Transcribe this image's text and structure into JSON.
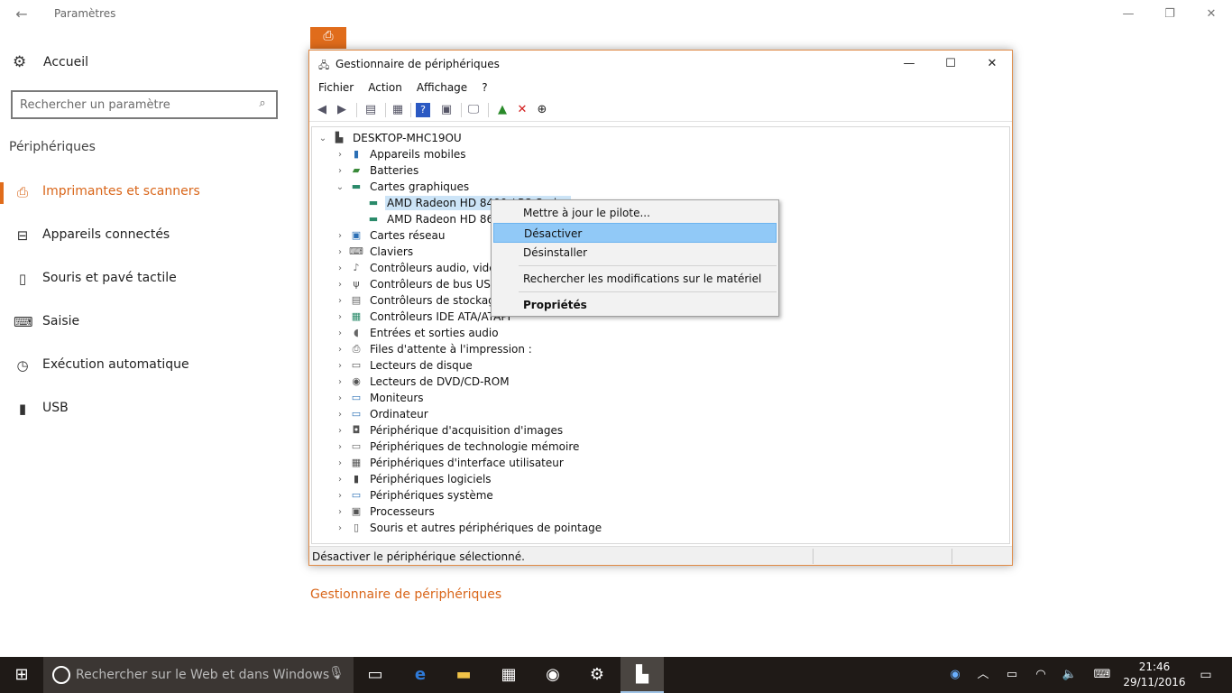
{
  "settings": {
    "title": "Paramètres",
    "home_label": "Accueil",
    "search_placeholder": "Rechercher un paramètre",
    "section_heading": "Périphériques",
    "nav": [
      {
        "label": "Imprimantes et scanners",
        "icon": "printer-icon",
        "active": true
      },
      {
        "label": "Appareils connectés",
        "icon": "devices-icon",
        "active": false
      },
      {
        "label": "Souris et pavé tactile",
        "icon": "mouse-icon",
        "active": false
      },
      {
        "label": "Saisie",
        "icon": "keyboard-icon",
        "active": false
      },
      {
        "label": "Exécution automatique",
        "icon": "autoplay-icon",
        "active": false
      },
      {
        "label": "USB",
        "icon": "usb-icon",
        "active": false
      }
    ],
    "related_link": "Gestionnaire de périphériques"
  },
  "device_manager": {
    "title": "Gestionnaire de périphériques",
    "menu": [
      "Fichier",
      "Action",
      "Affichage",
      "?"
    ],
    "root": "DESKTOP-MHC19OU",
    "tree": [
      {
        "label": "Appareils mobiles",
        "icon": "phone-icon",
        "expanded": false,
        "level": 1
      },
      {
        "label": "Batteries",
        "icon": "battery-icon",
        "expanded": false,
        "level": 1
      },
      {
        "label": "Cartes graphiques",
        "icon": "display-adapter-icon",
        "expanded": true,
        "level": 1
      },
      {
        "label": "AMD Radeon HD 8400 / R3 Series",
        "icon": "display-adapter-icon",
        "level": 2,
        "selected": true
      },
      {
        "label": "AMD Radeon HD 8600",
        "icon": "display-adapter-icon",
        "level": 2
      },
      {
        "label": "Cartes réseau",
        "icon": "network-icon",
        "expanded": false,
        "level": 1
      },
      {
        "label": "Claviers",
        "icon": "keyboard-icon",
        "expanded": false,
        "level": 1
      },
      {
        "label": "Contrôleurs audio, vidéo et jeu",
        "icon": "speaker-icon",
        "expanded": false,
        "level": 1
      },
      {
        "label": "Contrôleurs de bus USB",
        "icon": "usb-icon",
        "expanded": false,
        "level": 1
      },
      {
        "label": "Contrôleurs de stockage",
        "icon": "storage-icon",
        "expanded": false,
        "level": 1
      },
      {
        "label": "Contrôleurs IDE ATA/ATAPI",
        "icon": "ide-icon",
        "expanded": false,
        "level": 1
      },
      {
        "label": "Entrées et sorties audio",
        "icon": "audio-io-icon",
        "expanded": false,
        "level": 1
      },
      {
        "label": "Files d'attente à l'impression :",
        "icon": "print-queue-icon",
        "expanded": false,
        "level": 1
      },
      {
        "label": "Lecteurs de disque",
        "icon": "disk-icon",
        "expanded": false,
        "level": 1
      },
      {
        "label": "Lecteurs de DVD/CD-ROM",
        "icon": "dvd-icon",
        "expanded": false,
        "level": 1
      },
      {
        "label": "Moniteurs",
        "icon": "monitor-icon",
        "expanded": false,
        "level": 1
      },
      {
        "label": "Ordinateur",
        "icon": "computer-icon",
        "expanded": false,
        "level": 1
      },
      {
        "label": "Périphérique d'acquisition d'images",
        "icon": "camera-icon",
        "expanded": false,
        "level": 1
      },
      {
        "label": "Périphériques de technologie mémoire",
        "icon": "memory-icon",
        "expanded": false,
        "level": 1
      },
      {
        "label": "Périphériques d'interface utilisateur",
        "icon": "hid-icon",
        "expanded": false,
        "level": 1
      },
      {
        "label": "Périphériques logiciels",
        "icon": "software-device-icon",
        "expanded": false,
        "level": 1
      },
      {
        "label": "Périphériques système",
        "icon": "system-device-icon",
        "expanded": false,
        "level": 1
      },
      {
        "label": "Processeurs",
        "icon": "cpu-icon",
        "expanded": false,
        "level": 1
      },
      {
        "label": "Souris et autres périphériques de pointage",
        "icon": "mouse-icon",
        "expanded": false,
        "level": 1
      }
    ],
    "context_menu": {
      "update_driver": "Mettre à jour le pilote...",
      "disable": "Désactiver",
      "uninstall": "Désinstaller",
      "scan": "Rechercher les modifications sur le matériel",
      "properties": "Propriétés"
    },
    "status": "Désactiver le périphérique sélectionné."
  },
  "taskbar": {
    "search_placeholder": "Rechercher sur le Web et dans Windows",
    "time": "21:46",
    "date": "29/11/2016"
  },
  "colors": {
    "accent": "#e06c1b",
    "taskbar": "#1f1a17",
    "highlight": "#91c9f7"
  }
}
